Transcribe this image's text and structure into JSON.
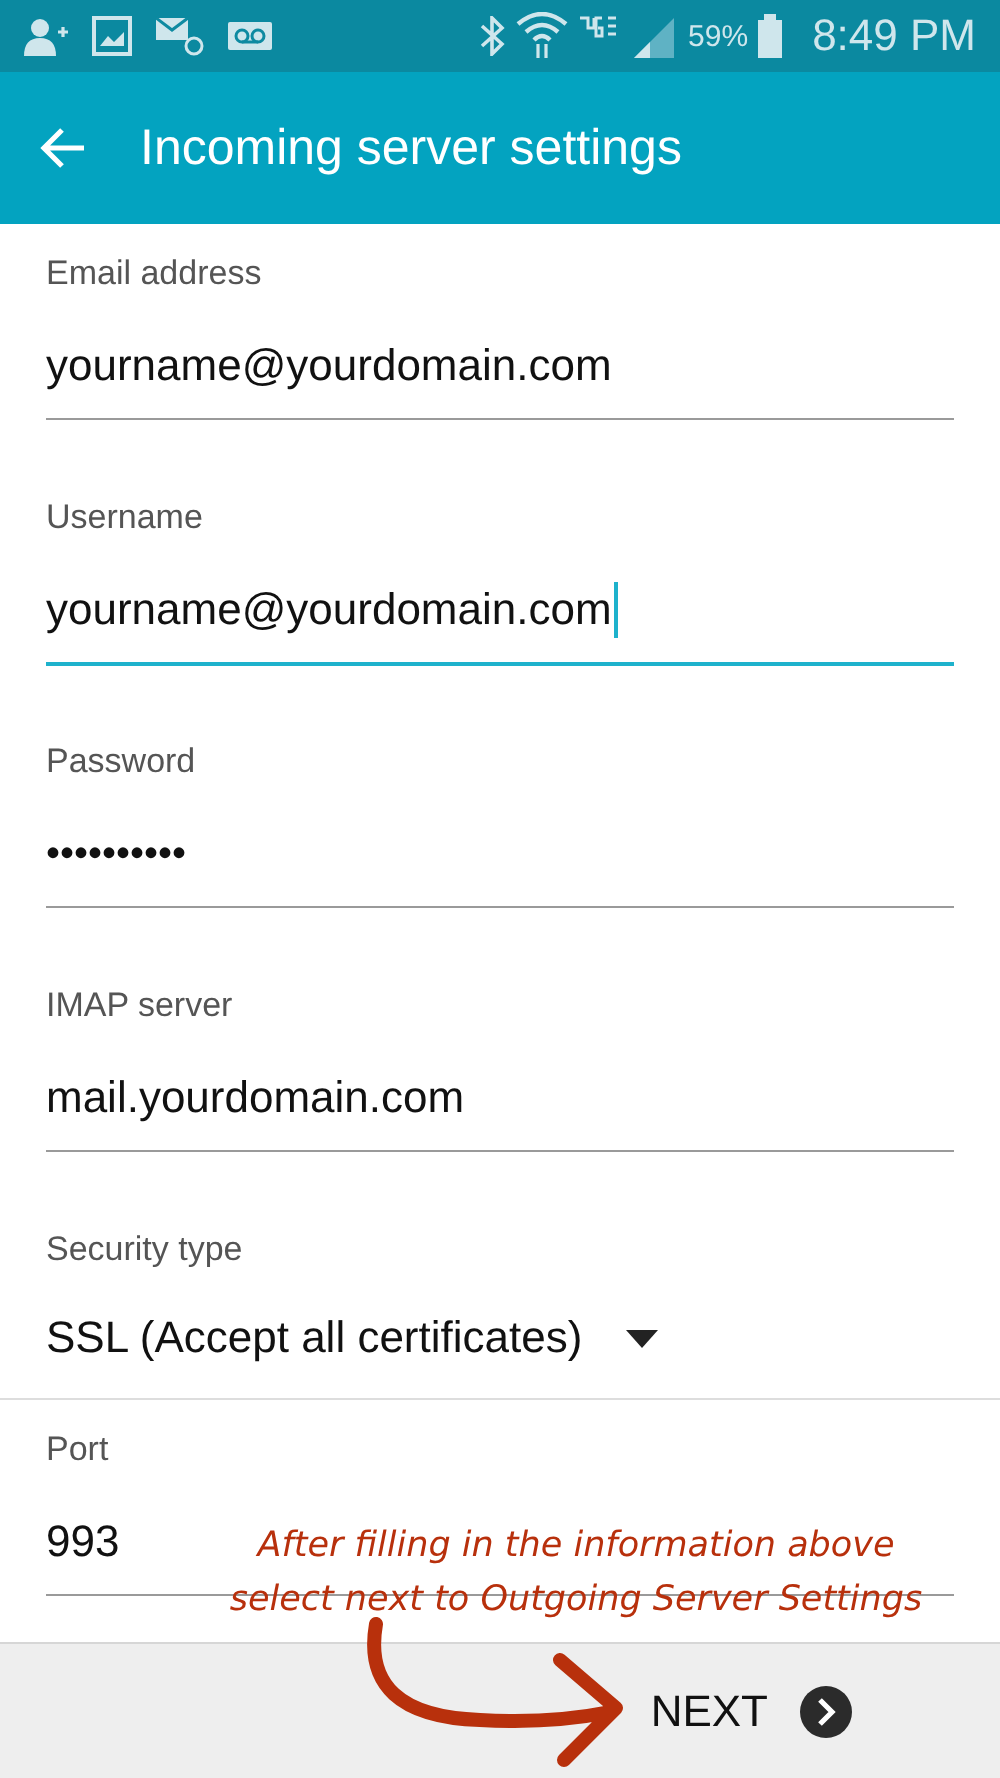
{
  "status_bar": {
    "battery": "59%",
    "time": "8:49 PM"
  },
  "app_bar": {
    "title": "Incoming server settings"
  },
  "fields": [
    {
      "kind": "text",
      "label": "Email address",
      "value": "yourname@yourdomain.com",
      "focused": false
    },
    {
      "kind": "text",
      "label": "Username",
      "value": "yourname@yourdomain.com",
      "focused": true
    },
    {
      "kind": "password",
      "label": "Password",
      "value": "••••••••••",
      "focused": false
    },
    {
      "kind": "text",
      "label": "IMAP server",
      "value": "mail.yourdomain.com",
      "focused": false
    },
    {
      "kind": "dropdown",
      "label": "Security type",
      "value": "SSL (Accept all certificates)",
      "focused": false
    },
    {
      "kind": "text",
      "label": "Port",
      "value": "993",
      "focused": false
    }
  ],
  "annotation": {
    "lines": [
      "After filling in the information above",
      "select next to Outgoing Server Settings"
    ]
  },
  "footer": {
    "next_label": "NEXT"
  }
}
